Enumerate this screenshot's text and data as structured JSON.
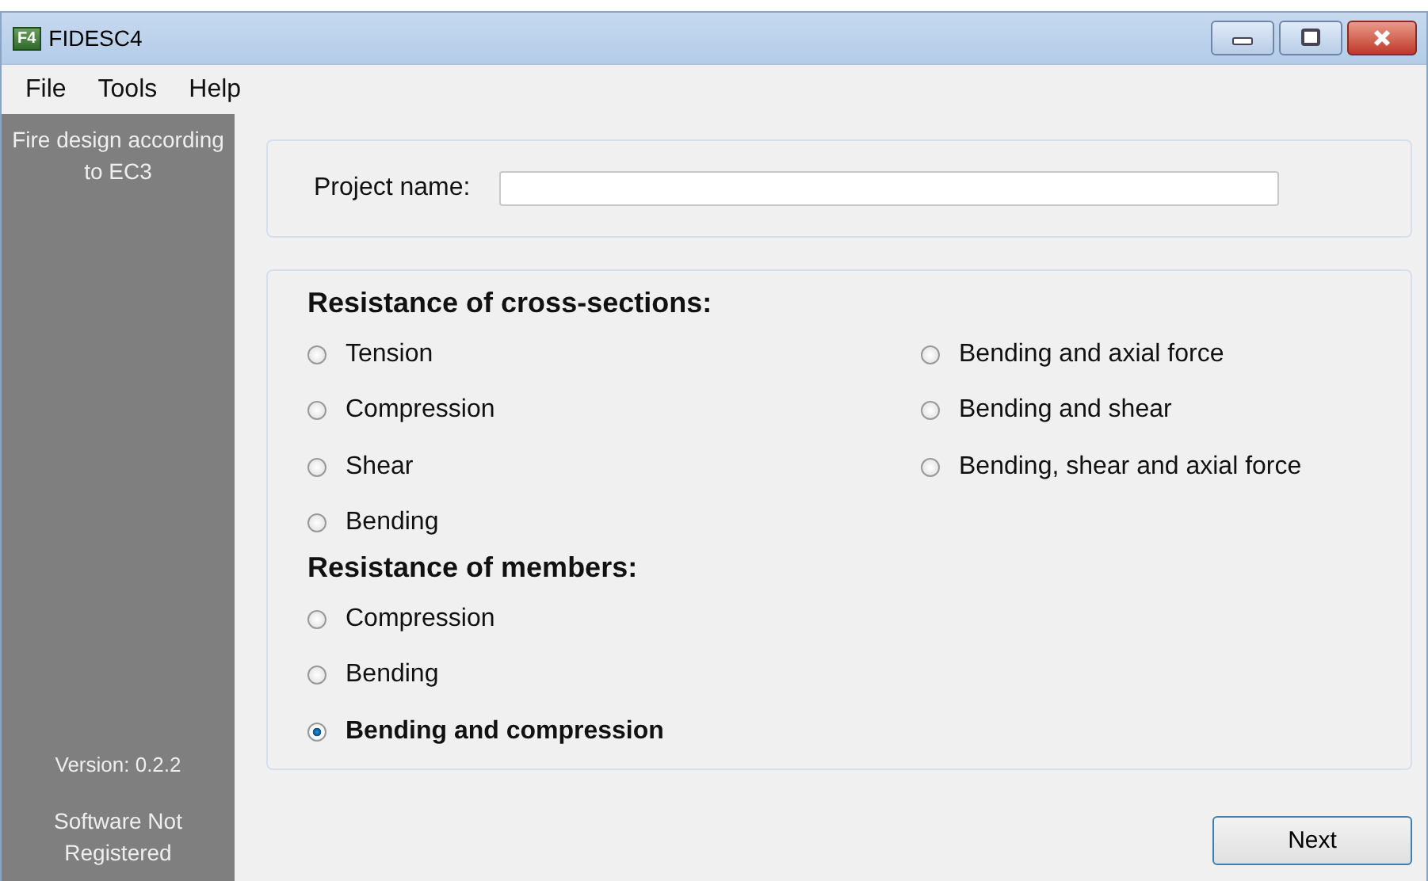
{
  "window": {
    "title": "FIDESC4",
    "icon_text": "F4"
  },
  "menu": [
    "File",
    "Tools",
    "Help"
  ],
  "sidebar": {
    "heading": "Fire design according to EC3",
    "version": "Version: 0.2.2",
    "registration": "Software Not Registered"
  },
  "project": {
    "label": "Project name:"
  },
  "sections": [
    {
      "title": "Resistance of cross-sections:",
      "columns": [
        [
          {
            "label": "Tension",
            "selected": false
          },
          {
            "label": "Compression",
            "selected": false
          },
          {
            "label": "Shear",
            "selected": false
          },
          {
            "label": "Bending",
            "selected": false
          }
        ],
        [
          {
            "label": "Bending and axial force",
            "selected": false
          },
          {
            "label": "Bending and shear",
            "selected": false
          },
          {
            "label": "Bending, shear and axial force",
            "selected": false
          }
        ]
      ]
    },
    {
      "title": "Resistance of members:",
      "columns": [
        [
          {
            "label": "Compression",
            "selected": false
          },
          {
            "label": "Bending",
            "selected": false
          },
          {
            "label": "Bending and compression",
            "selected": true
          }
        ]
      ]
    }
  ],
  "buttons": [
    "Next"
  ]
}
